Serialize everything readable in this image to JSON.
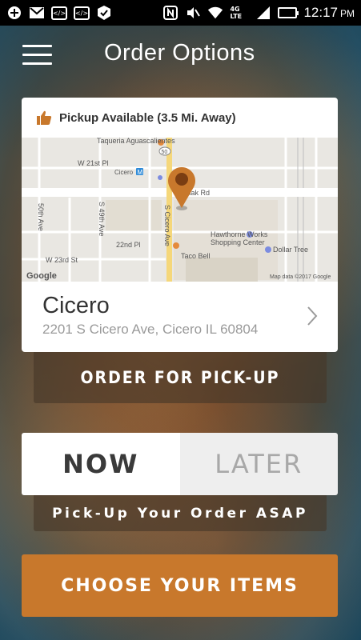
{
  "status_bar": {
    "time": "12:17",
    "ampm": "PM",
    "network": "4G LTE",
    "left_icons": [
      "plus-icon",
      "mail-icon",
      "code-icon",
      "code-icon",
      "check-icon"
    ],
    "right_icons": [
      "nfc-icon",
      "mute-icon",
      "wifi-icon",
      "signal-icon",
      "battery-icon"
    ]
  },
  "header": {
    "title": "Order Options",
    "menu_icon": "hamburger-menu-icon"
  },
  "location_card": {
    "availability": "Pickup Available (3.5 Mi. Away)",
    "availability_icon": "thumbs-up-icon",
    "map": {
      "labels": {
        "taqueria": "Taqueria Aguascalientes",
        "w21": "W 21st Pl",
        "cicero_station": "Cicero",
        "cermak": "rmak Rd",
        "route": "50",
        "ave50": "50th Ave",
        "ave49": "S 49th Ave",
        "pl22": "22nd Pl",
        "cicero_ave": "S Cicero Ave",
        "hawthorne1": "Hawthorne Works",
        "hawthorne2": "Shopping Center",
        "dollar_tree": "Dollar Tree",
        "w23": "W 23rd St",
        "taco_bell": "Taco Bell",
        "google": "Google",
        "copyright": "Map data ©2017 Google"
      }
    },
    "store_name": "Cicero",
    "store_address": "2201 S Cicero Ave, Cicero IL 60804"
  },
  "order_type_button": "ORDER FOR PICK-UP",
  "time_toggle": {
    "now": "NOW",
    "later": "LATER",
    "selected": "NOW"
  },
  "asap_note": "Pick-Up Your Order ASAP",
  "cta": "CHOOSE YOUR ITEMS",
  "colors": {
    "accent": "#c8782c",
    "map_pin": "#c8782c",
    "status_bar": "#000000"
  }
}
